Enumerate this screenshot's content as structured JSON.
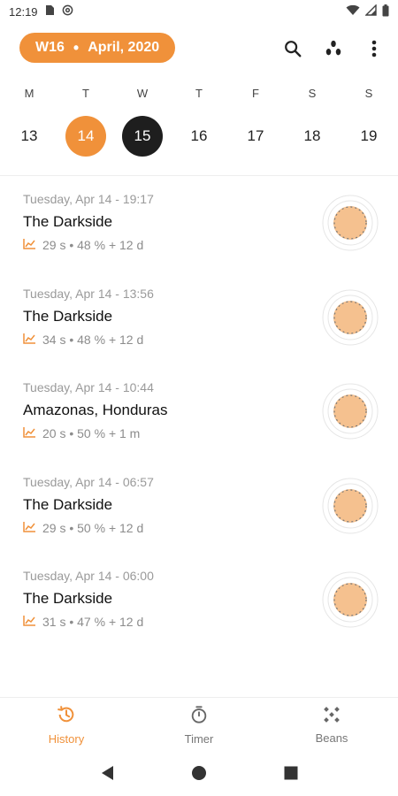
{
  "status_bar": {
    "time": "12:19",
    "left_icons": [
      "sim-card-icon",
      "at-sign-icon"
    ],
    "right_icons": [
      "wifi-icon",
      "signal-icon",
      "battery-icon"
    ]
  },
  "app_bar": {
    "week": "W16",
    "separator": "•",
    "month": "April, 2020",
    "actions": [
      "search-icon",
      "beans-filter-icon",
      "more-vert-icon"
    ]
  },
  "week": {
    "days": [
      {
        "letter": "M",
        "date": "13"
      },
      {
        "letter": "T",
        "date": "14"
      },
      {
        "letter": "W",
        "date": "15"
      },
      {
        "letter": "T",
        "date": "16"
      },
      {
        "letter": "F",
        "date": "17"
      },
      {
        "letter": "S",
        "date": "18"
      },
      {
        "letter": "S",
        "date": "19"
      }
    ],
    "selected_date": "14",
    "today_date": "15"
  },
  "history": [
    {
      "when": "Tuesday, Apr 14 - 19:17",
      "title": "The Darkside",
      "stats": "29 s • 48 % + 12 d"
    },
    {
      "when": "Tuesday, Apr 14 - 13:56",
      "title": "The Darkside",
      "stats": "34 s • 48 % + 12 d"
    },
    {
      "when": "Tuesday, Apr 14 - 10:44",
      "title": "Amazonas, Honduras",
      "stats": "20 s • 50 % + 1 m"
    },
    {
      "when": "Tuesday, Apr 14 - 06:57",
      "title": "The Darkside",
      "stats": "29 s • 50 % + 12 d"
    },
    {
      "when": "Tuesday, Apr 14 - 06:00",
      "title": "The Darkside",
      "stats": "31 s • 47 % + 12 d"
    }
  ],
  "bottom_nav": {
    "items": [
      {
        "label": "History",
        "icon": "history-icon",
        "active": true
      },
      {
        "label": "Timer",
        "icon": "timer-icon",
        "active": false
      },
      {
        "label": "Beans",
        "icon": "beans-icon",
        "active": false
      }
    ]
  },
  "system_nav": [
    "back-icon",
    "home-icon",
    "recents-icon"
  ],
  "colors": {
    "accent": "#f0913a",
    "today": "#1e1e1e",
    "badge_fill": "#f5c18f"
  }
}
